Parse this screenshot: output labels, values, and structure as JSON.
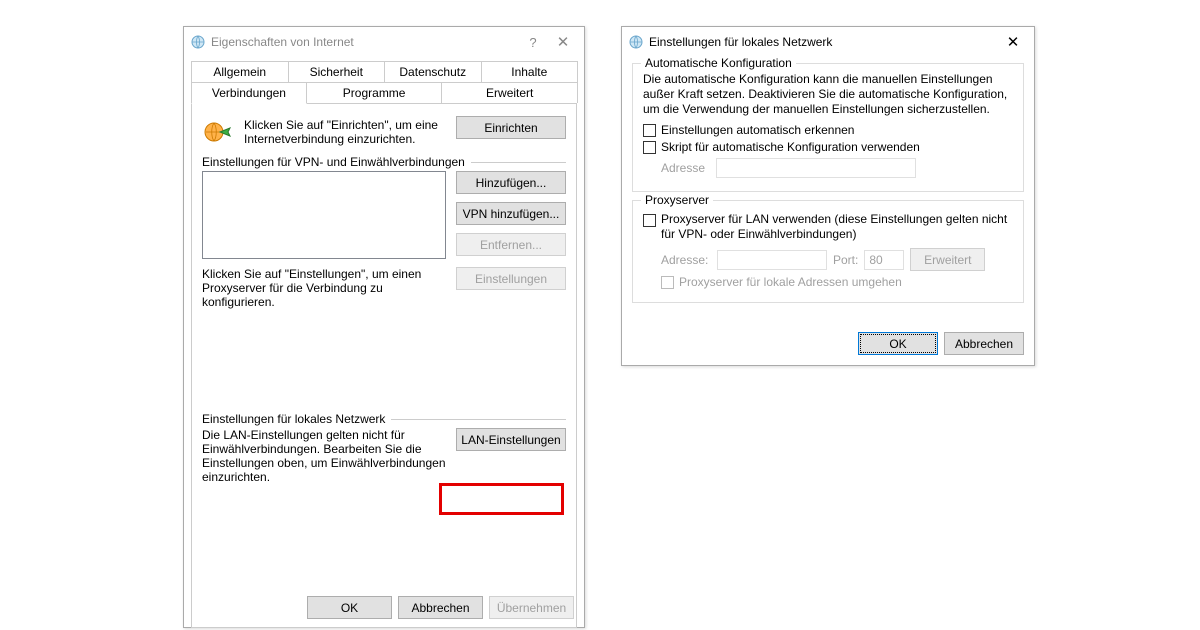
{
  "dialog1": {
    "title": "Eigenschaften von Internet",
    "tabs_top": [
      "Allgemein",
      "Sicherheit",
      "Datenschutz",
      "Inhalte"
    ],
    "tabs_bottom": [
      "Verbindungen",
      "Programme",
      "Erweitert"
    ],
    "setup_text": "Klicken Sie auf \"Einrichten\", um eine Internetverbindung einzurichten.",
    "btn_setup": "Einrichten",
    "vpn_section": "Einstellungen für VPN- und Einwählverbindungen",
    "btn_add": "Hinzufügen...",
    "btn_vpn_add": "VPN hinzufügen...",
    "btn_remove": "Entfernen...",
    "proxy_text": "Klicken Sie auf \"Einstellungen\", um einen Proxyserver für die Verbindung zu konfigurieren.",
    "btn_settings": "Einstellungen",
    "lan_section": "Einstellungen für lokales Netzwerk",
    "lan_text": "Die LAN-Einstellungen gelten nicht für Einwählverbindungen. Bearbeiten Sie die Einstellungen oben, um Einwählverbindungen einzurichten.",
    "btn_lan": "LAN-Einstellungen",
    "btn_ok": "OK",
    "btn_cancel": "Abbrechen",
    "btn_apply": "Übernehmen"
  },
  "dialog2": {
    "title": "Einstellungen für lokales Netzwerk",
    "auto_group": "Automatische Konfiguration",
    "auto_text": "Die automatische Konfiguration kann die manuellen Einstellungen außer Kraft setzen. Deaktivieren Sie die automatische Konfiguration, um die Verwendung der manuellen Einstellungen sicherzustellen.",
    "chk_auto_detect": "Einstellungen automatisch erkennen",
    "chk_auto_script": "Skript für automatische Konfiguration verwenden",
    "lbl_address": "Adresse",
    "proxy_group": "Proxyserver",
    "chk_proxy": "Proxyserver für LAN verwenden (diese Einstellungen gelten nicht für VPN- oder Einwählverbindungen)",
    "lbl_address2": "Adresse:",
    "lbl_port": "Port:",
    "port_value": "80",
    "btn_advanced": "Erweitert",
    "chk_bypass": "Proxyserver für lokale Adressen umgehen",
    "btn_ok": "OK",
    "btn_cancel": "Abbrechen"
  }
}
